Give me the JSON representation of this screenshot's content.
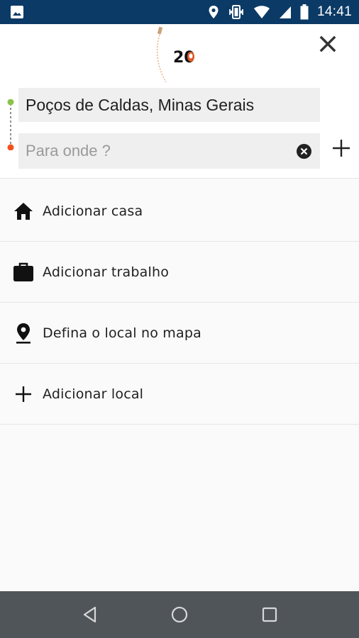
{
  "status_bar": {
    "time": "14:41",
    "icons": [
      "image-icon",
      "location-icon",
      "vibrate-icon",
      "wifi-icon",
      "signal-icon",
      "battery-icon"
    ]
  },
  "header": {
    "logo_text": "20",
    "origin": "Poços de Caldas, Minas Gerais",
    "destination_placeholder": "Para onde ?",
    "destination_value": "",
    "colors": {
      "origin_dot": "#8bc34a",
      "destination_dot": "#f4511e"
    }
  },
  "list": {
    "items": [
      {
        "icon": "home-icon",
        "label": "Adicionar casa"
      },
      {
        "icon": "briefcase-icon",
        "label": "Adicionar trabalho"
      },
      {
        "icon": "map-pin-icon",
        "label": "Defina o local no mapa"
      },
      {
        "icon": "plus-icon",
        "label": "Adicionar local"
      }
    ]
  },
  "nav_bar": {
    "buttons": [
      "back-icon",
      "home-circle-icon",
      "recents-icon"
    ]
  }
}
